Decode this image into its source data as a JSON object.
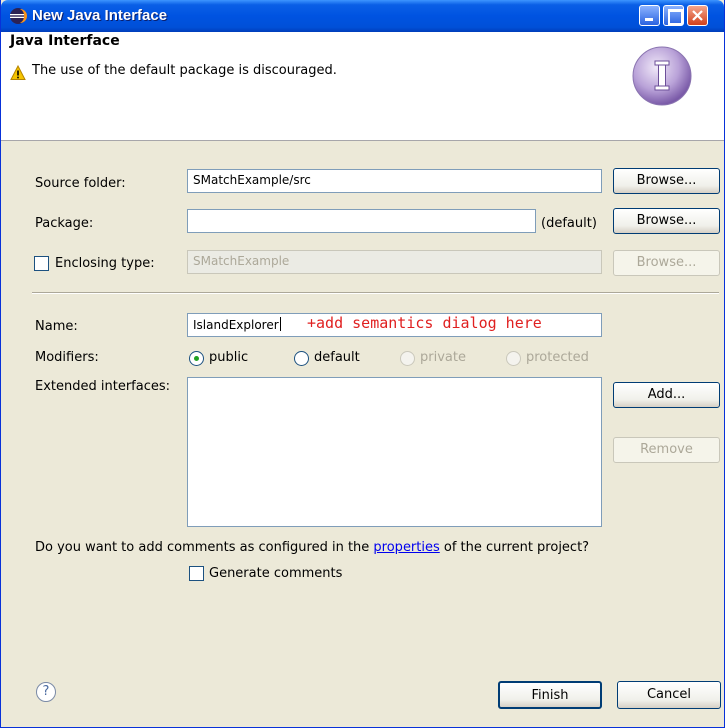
{
  "window": {
    "title": "New Java Interface",
    "accent": "#0053e1"
  },
  "header": {
    "title": "Java Interface",
    "message": "The use of the default package is discouraged.",
    "warning_icon": "warning-icon",
    "wizard_icon": "interface-wizard-icon"
  },
  "form": {
    "source_folder": {
      "label": "Source folder:",
      "value": "SMatchExample/src",
      "button": "Browse..."
    },
    "package": {
      "label": "Package:",
      "value": "",
      "hint": "(default)",
      "button": "Browse..."
    },
    "enclosing": {
      "label": "Enclosing type:",
      "value": "SMatchExample",
      "button": "Browse...",
      "checked": false
    },
    "name": {
      "label": "Name:",
      "value": "IslandExplorer",
      "annotation": "+add semantics dialog here",
      "annotation_color": "#e02020"
    },
    "modifiers": {
      "label": "Modifiers:",
      "options": [
        {
          "label": "public",
          "selected": true,
          "enabled": true
        },
        {
          "label": "default",
          "selected": false,
          "enabled": true
        },
        {
          "label": "private",
          "selected": false,
          "enabled": false
        },
        {
          "label": "protected",
          "selected": false,
          "enabled": false
        }
      ]
    },
    "extended": {
      "label": "Extended interfaces:",
      "add_button": "Add...",
      "remove_button": "Remove"
    },
    "comments": {
      "prompt_before": "Do you want to add comments as configured in the ",
      "prompt_link": "properties",
      "prompt_after": " of the current project?",
      "checkbox_label": "Generate comments",
      "checked": false
    }
  },
  "footer": {
    "help_icon": "help-icon",
    "help_glyph": "?",
    "finish_button": "Finish",
    "cancel_button": "Cancel"
  }
}
